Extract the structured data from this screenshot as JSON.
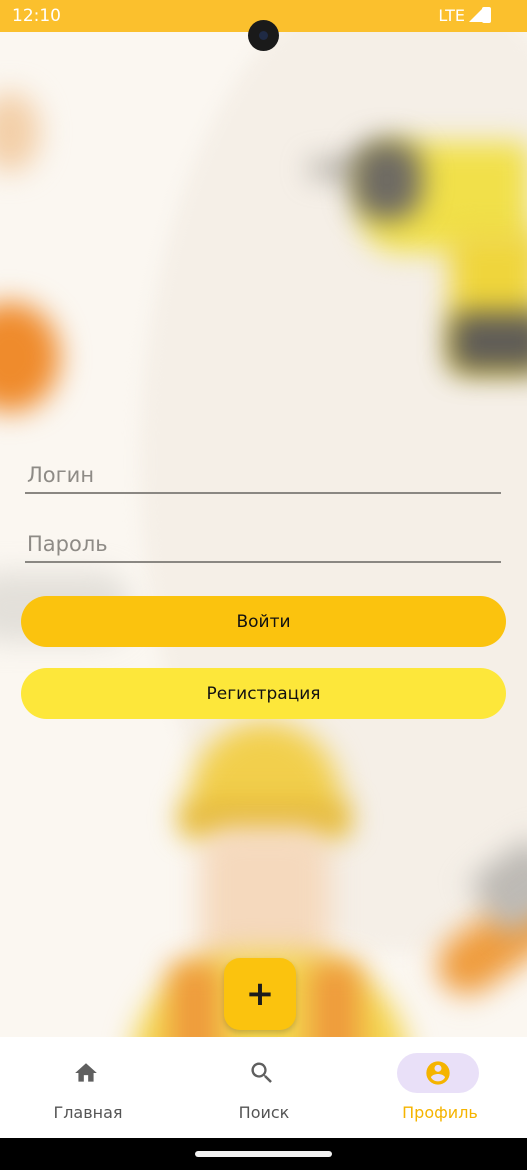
{
  "status_bar": {
    "time": "12:10",
    "network": "LTE"
  },
  "form": {
    "login_placeholder": "Логин",
    "password_placeholder": "Пароль",
    "login_button": "Войти",
    "register_button": "Регистрация"
  },
  "fab": {
    "label": "+"
  },
  "nav": {
    "items": [
      {
        "label": "Главная",
        "icon": "home-icon",
        "active": false
      },
      {
        "label": "Поиск",
        "icon": "search-icon",
        "active": false
      },
      {
        "label": "Профиль",
        "icon": "account-circle-icon",
        "active": true
      }
    ]
  },
  "colors": {
    "accent": "#fbc30e",
    "secondary_button": "#fde73a",
    "active_nav": "#f5b400",
    "active_nav_pill": "#e9e0f8"
  }
}
